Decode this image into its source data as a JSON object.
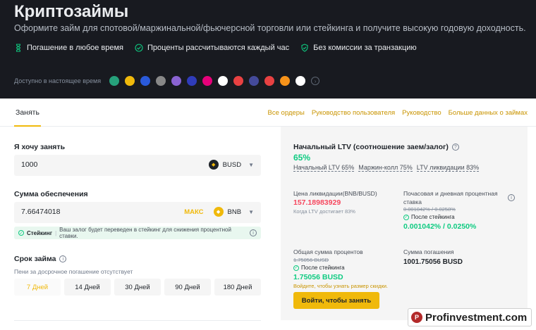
{
  "hero": {
    "title": "Криптозаймы",
    "subtitle": "Оформите займ для спотовой/маржинальной/фьючерсной торговли или стейкинга и получите высокую годовую доходность.",
    "features": [
      {
        "icon": "hourglass-icon",
        "label": "Погашение в любое время"
      },
      {
        "icon": "check-circle-icon",
        "label": "Проценты рассчитываются каждый час"
      },
      {
        "icon": "shield-check-icon",
        "label": "Без комиссии за транзакцию"
      }
    ],
    "available_label": "Доступно в настоящее время",
    "coins": [
      {
        "name": "tether-coin-icon",
        "color": "#26a17b"
      },
      {
        "name": "bnb-coin-icon",
        "color": "#f0b90b"
      },
      {
        "name": "chainlink-coin-icon",
        "color": "#2a5ada"
      },
      {
        "name": "coin-icon-4",
        "color": "#888888"
      },
      {
        "name": "coin-icon-5",
        "color": "#8a63d2"
      },
      {
        "name": "coin-icon-6",
        "color": "#2f3cba"
      },
      {
        "name": "polkadot-coin-icon",
        "color": "#e6007a"
      },
      {
        "name": "coin-icon-8",
        "color": "#ffffff"
      },
      {
        "name": "coin-icon-9",
        "color": "#e84142"
      },
      {
        "name": "coin-icon-10",
        "color": "#444a9a"
      },
      {
        "name": "avalanche-coin-icon",
        "color": "#e84142"
      },
      {
        "name": "coin-icon-12",
        "color": "#f7931a"
      },
      {
        "name": "coin-icon-13",
        "color": "#ffffff"
      }
    ]
  },
  "nav": {
    "tab_borrow": "Занять",
    "links": [
      "Все ордеры",
      "Руководство пользователя",
      "Руководство",
      "Больше данных о займах"
    ]
  },
  "form": {
    "borrow_label": "Я хочу занять",
    "borrow_value": "1000",
    "borrow_token": "BUSD",
    "collateral_label": "Сумма обеспечения",
    "collateral_value": "7.66474018",
    "max_label": "МАКС",
    "collateral_token": "BNB",
    "staking_label": "Стейкинг",
    "staking_note": "Ваш залог будет переведен в стейкинг для снижения процентной ставки.",
    "term_label": "Срок займа",
    "term_note": "Пени за досрочное погашение отсутствует",
    "terms": [
      "7 Дней",
      "14 Дней",
      "30 Дней",
      "90 Дней",
      "180 Дней"
    ],
    "selected_term": "7 Дней"
  },
  "summary": {
    "ltv_title": "Начальный LTV (соотношение заем/залог)",
    "ltv_value": "65%",
    "ltv_initial": "Начальный LTV 65%",
    "ltv_margin_call": "Маржин-колл 75%",
    "ltv_liquidation": "LTV ликвидации 83%",
    "liq_price_label": "Цена ликвидации(BNB/BUSD)",
    "liq_price_value": "157.18983929",
    "liq_price_note": "Когда LTV достигает 83%",
    "rate_label": "Почасовая и дневная процентная ставка",
    "rate_old": "0.001042% / 0.0258%",
    "after_staking": "После стейкинга",
    "rate_new": "0.001042% / 0.0250%",
    "interest_label": "Общая сумма процентов",
    "interest_old": "1.75056 BUSD",
    "interest_new": "1.75056 BUSD",
    "login_note": "Войдите, чтобы узнать размер скидки.",
    "repay_label": "Сумма погашения",
    "repay_value": "1001.75056 BUSD",
    "login_button": "Войти, чтобы занять"
  },
  "watermark": {
    "logo_letter": "P",
    "text": "Profinvestment.com"
  },
  "colors": {
    "accent": "#f0b90b",
    "green": "#0ecb81",
    "red": "#f6465d",
    "hero_bg": "#181a20"
  }
}
